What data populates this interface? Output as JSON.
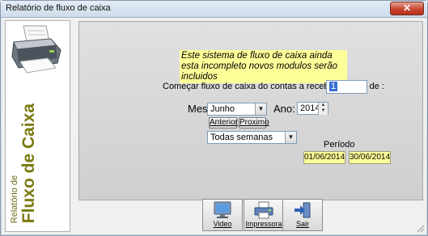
{
  "window": {
    "title": "Relatório de fluxo de caixa",
    "close_label": "✕"
  },
  "sidebar": {
    "title_small": "Relatório de",
    "title_big": "Fluxo de Caixa"
  },
  "notice": {
    "text": "Este sistema de fluxo de caixa ainda esta incompleto novos modulos serão incluidos"
  },
  "start_field": {
    "label": "Começar fluxo de caixa do contas a receber a partir de :",
    "value": "1"
  },
  "month": {
    "label": "Mes:",
    "value": "Junho"
  },
  "year": {
    "label": "Ano:",
    "value": "2014"
  },
  "nav": {
    "prev_label": "Anterior",
    "next_label": "Proximo"
  },
  "weeks": {
    "value": "Todas semanas"
  },
  "period": {
    "label": "Período",
    "start": "01/06/2014",
    "end": "30/06/2014"
  },
  "toolbar": {
    "video_label": "Video",
    "printer_label": "Impressora",
    "exit_label": "Sair"
  }
}
